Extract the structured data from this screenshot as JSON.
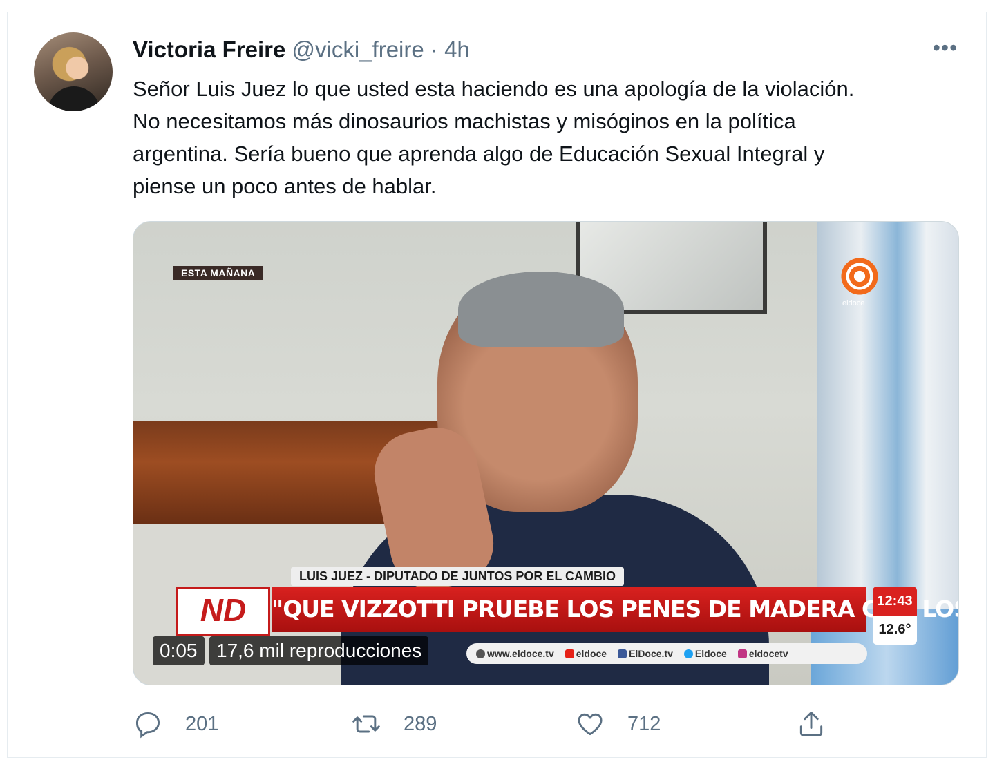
{
  "tweet": {
    "name": "Victoria Freire",
    "handle": "@vicki_freire",
    "separator": "·",
    "time": "4h",
    "more": "•••",
    "text_lines": [
      "Señor Luis Juez lo que usted esta haciendo es una apología de la violación.",
      "No necesitamos más dinosaurios machistas y misóginos en la política",
      "argentina. Sería bueno que aprenda algo de Educación Sexual Integral y",
      "piense un poco antes de hablar."
    ]
  },
  "video": {
    "tag": "ESTA MAÑANA",
    "channel_logo_text": "eldoce",
    "subtitle": "LUIS JUEZ - DIPUTADO DE JUNTOS POR EL CAMBIO",
    "program_logo": "ND",
    "headline": "\"QUE VIZZOTTI PRUEBE LOS PENES DE MADERA CON LOS VACUNADOS VIP\"",
    "clock_time": "12:43",
    "clock_temp": "12.6°",
    "social": [
      "www.eldoce.tv",
      "eldoce",
      "ElDoce.tv",
      "Eldoce",
      "eldocetv"
    ],
    "elapsed": "0:05",
    "views": "17,6 mil reproducciones"
  },
  "actions": {
    "replies": "201",
    "retweets": "289",
    "likes": "712"
  },
  "colors": {
    "text": "#0f1419",
    "muted": "#5b7083",
    "border": "#e6ecf0",
    "headline_red": "#d9211f"
  }
}
